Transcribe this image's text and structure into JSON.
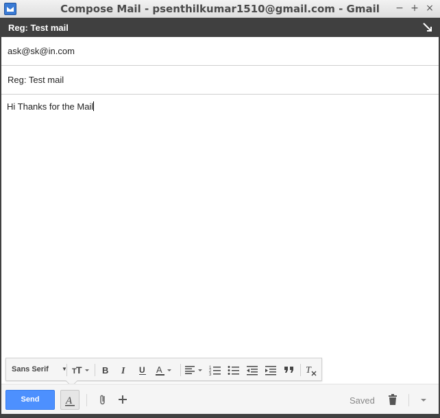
{
  "window": {
    "title": "Compose Mail - psenthilkumar1510@gmail.com - Gmail",
    "controls": {
      "minimize": "−",
      "maximize": "+",
      "close": "×"
    }
  },
  "compose": {
    "header_title": "Reg: Test mail",
    "to_value": "ask@sk@in.com",
    "subject_value": "Reg: Test mail",
    "body_text": "Hi Thanks for the Mail"
  },
  "format_toolbar": {
    "font_family": "Sans Serif",
    "icons": [
      "text-size-icon",
      "bold-icon",
      "italic-icon",
      "underline-icon",
      "text-color-icon",
      "align-icon",
      "numbered-list-icon",
      "bulleted-list-icon",
      "indent-less-icon",
      "indent-more-icon",
      "quote-icon",
      "remove-formatting-icon"
    ]
  },
  "actions": {
    "send_label": "Send",
    "saved_label": "Saved"
  },
  "colors": {
    "header_bg": "#404040",
    "send_bg": "#4d90fe",
    "toolbar_bg": "#f5f5f5"
  }
}
